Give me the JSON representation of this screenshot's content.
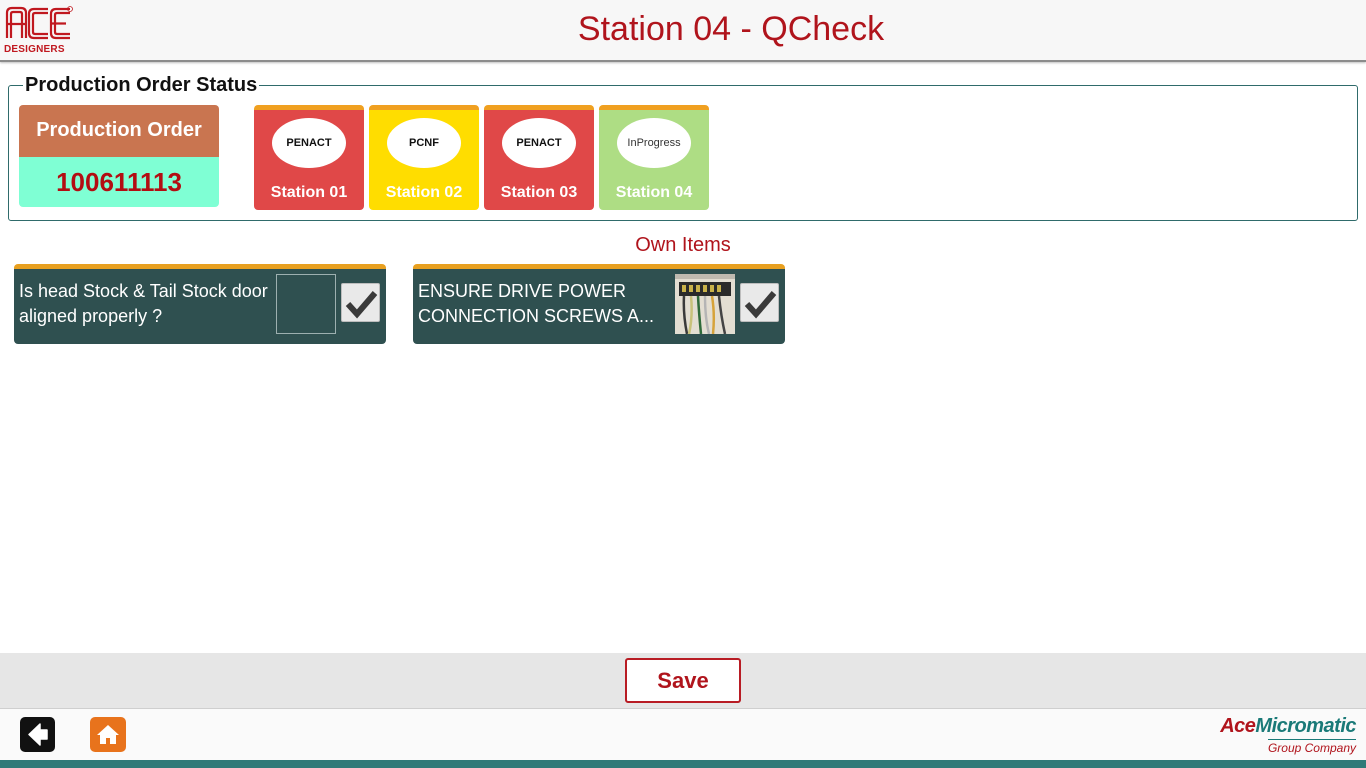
{
  "header": {
    "logo_text": "ACE",
    "logo_sub": "DESIGNERS",
    "title": "Station 04 - QCheck"
  },
  "status": {
    "legend": "Production Order Status",
    "po_label": "Production Order",
    "po_value": "100611113",
    "stations": [
      {
        "badge": "PENACT",
        "name": "Station 01",
        "color": "#e04848"
      },
      {
        "badge": "PCNF",
        "name": "Station 02",
        "color": "#ffdd00"
      },
      {
        "badge": "PENACT",
        "name": "Station 03",
        "color": "#e04848"
      },
      {
        "badge": "InProgress",
        "name": "Station 04",
        "color": "#aedd84"
      }
    ]
  },
  "own_items": {
    "title": "Own Items",
    "items": [
      {
        "text": "Is head Stock & Tail Stock door aligned properly ?",
        "has_image": false,
        "checked": true
      },
      {
        "text": "ENSURE DRIVE POWER CONNECTION SCREWS A...",
        "has_image": true,
        "checked": true
      }
    ]
  },
  "actions": {
    "save_label": "Save"
  },
  "footer": {
    "brand_part1": "Ace",
    "brand_part2": "Micromatic",
    "brand_sub": "Group Company",
    "back_icon": "back-arrow-icon",
    "home_icon": "home-icon"
  },
  "colors": {
    "accent_red": "#b0141c",
    "teal": "#2f5050",
    "orange": "#e8731c"
  }
}
